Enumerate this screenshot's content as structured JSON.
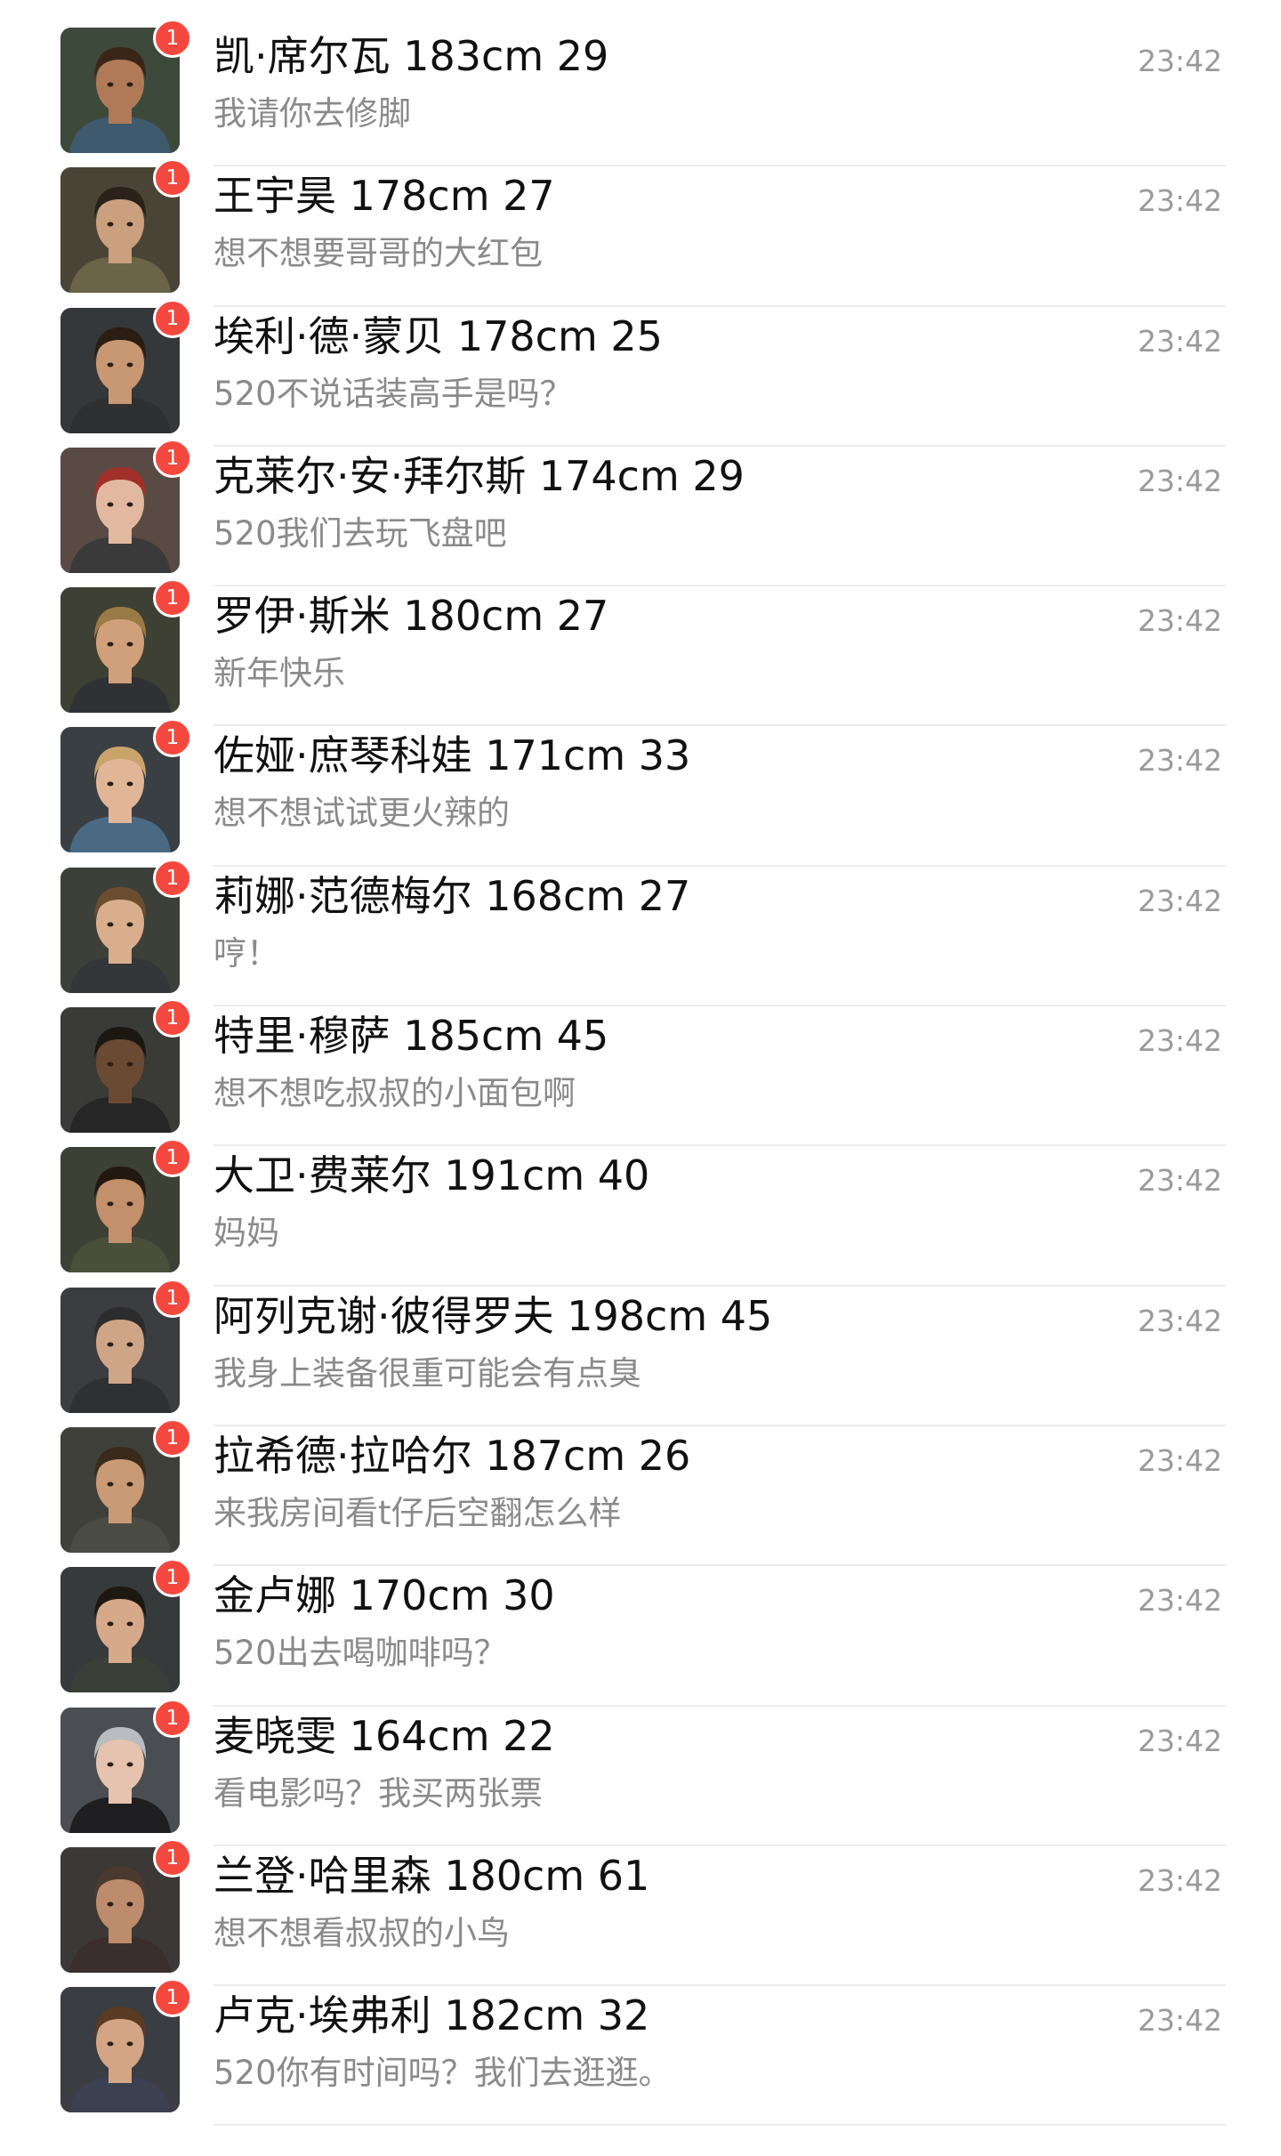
{
  "chats": [
    {
      "name": "凯·席尔瓦 183cm 29",
      "preview": "我请你去修脚",
      "time": "23:42",
      "unread": "1",
      "avatar_icon": "male-soldier-cap-headset-avatar",
      "bg": "#3d4a3b",
      "skin": "#b07a58",
      "hair": "#3a2618",
      "gear": "#3f5a6e"
    },
    {
      "name": "王宇昊 178cm 27",
      "preview": "想不想要哥哥的大红包",
      "time": "23:42",
      "unread": "1",
      "avatar_icon": "masked-soldier-helmet-avatar",
      "bg": "#4a4436",
      "skin": "#caa07e",
      "hair": "#2a221a",
      "gear": "#6b6448"
    },
    {
      "name": "埃利·德·蒙贝 178cm 25",
      "preview": "520不说话装高手是吗？",
      "time": "23:42",
      "unread": "1",
      "avatar_icon": "night-vision-soldier-avatar",
      "bg": "#35383a",
      "skin": "#c89873",
      "hair": "#2b1d14",
      "gear": "#2d2f31"
    },
    {
      "name": "克莱尔·安·拜尔斯 174cm 29",
      "preview": "520我们去玩飞盘吧",
      "time": "23:42",
      "unread": "1",
      "avatar_icon": "red-hair-woman-avatar",
      "bg": "#5a4a44",
      "skin": "#e2b9a0",
      "hair": "#a1302a",
      "gear": "#3b3a3a"
    },
    {
      "name": "罗伊·斯米 180cm 27",
      "preview": "新年快乐",
      "time": "23:42",
      "unread": "1",
      "avatar_icon": "blond-soldier-headset-avatar",
      "bg": "#3e4034",
      "skin": "#d0a07a",
      "hair": "#9a7b45",
      "gear": "#2f3134"
    },
    {
      "name": "佐娅·庶琴科娃 171cm 33",
      "preview": "想不想试试更火辣的",
      "time": "23:42",
      "unread": "1",
      "avatar_icon": "goggles-woman-avatar",
      "bg": "#3a3f44",
      "skin": "#e0b696",
      "hair": "#c9a46a",
      "gear": "#4a6a84"
    },
    {
      "name": "莉娜·范德梅尔 168cm 27",
      "preview": "哼！",
      "time": "23:42",
      "unread": "1",
      "avatar_icon": "helmet-woman-avatar",
      "bg": "#3c4038",
      "skin": "#d9ae8c",
      "hair": "#6b4d30",
      "gear": "#33373a"
    },
    {
      "name": "特里·穆萨 185cm 45",
      "preview": "想不想吃叔叔的小面包啊",
      "time": "23:42",
      "unread": "1",
      "avatar_icon": "bald-soldier-headset-avatar",
      "bg": "#3a3a36",
      "skin": "#6b4a34",
      "hair": "#1d1712",
      "gear": "#262626"
    },
    {
      "name": "大卫·费莱尔 191cm 40",
      "preview": "妈妈",
      "time": "23:42",
      "unread": "1",
      "avatar_icon": "bearded-soldier-avatar",
      "bg": "#3d4035",
      "skin": "#c2906a",
      "hair": "#22180f",
      "gear": "#4a4f3a"
    },
    {
      "name": "阿列克谢·彼得罗夫 198cm 45",
      "preview": "我身上装备很重可能会有点臭",
      "time": "23:42",
      "unread": "1",
      "avatar_icon": "balaclava-soldier-avatar",
      "bg": "#3b3d40",
      "skin": "#cfa587",
      "hair": "#2c2c2c",
      "gear": "#2e3032"
    },
    {
      "name": "拉希德·拉哈尔 187cm 26",
      "preview": "来我房间看t仔后空翻怎么样",
      "time": "23:42",
      "unread": "1",
      "avatar_icon": "glasses-man-avatar",
      "bg": "#40403a",
      "skin": "#c99a76",
      "hair": "#3a2a1c",
      "gear": "#4b4d44"
    },
    {
      "name": "金卢娜 170cm 30",
      "preview": "520出去喝咖啡吗？",
      "time": "23:42",
      "unread": "1",
      "avatar_icon": "dark-hair-woman-avatar",
      "bg": "#363a3a",
      "skin": "#d6a98a",
      "hair": "#1e1813",
      "gear": "#3a3f38"
    },
    {
      "name": "麦晓雯 164cm 22",
      "preview": "看电影吗？我买两张票",
      "time": "23:42",
      "unread": "1",
      "avatar_icon": "masked-silver-hair-woman-avatar",
      "bg": "#4a4e52",
      "skin": "#e6c3ae",
      "hair": "#b9bcc0",
      "gear": "#1f1f21"
    },
    {
      "name": "兰登·哈里森 180cm 61",
      "preview": "想不想看叔叔的小鸟",
      "time": "23:42",
      "unread": "1",
      "avatar_icon": "older-bearded-man-avatar",
      "bg": "#3b3836",
      "skin": "#bc8c6c",
      "hair": "#4a3a30",
      "gear": "#3a2f2a"
    },
    {
      "name": "卢克·埃弗利 182cm 32",
      "preview": "520你有时间吗？我们去逛逛。",
      "time": "23:42",
      "unread": "1",
      "avatar_icon": "brown-hair-man-avatar",
      "bg": "#3a3d42",
      "skin": "#d3a585",
      "hair": "#5a3a22",
      "gear": "#3b4150"
    }
  ]
}
